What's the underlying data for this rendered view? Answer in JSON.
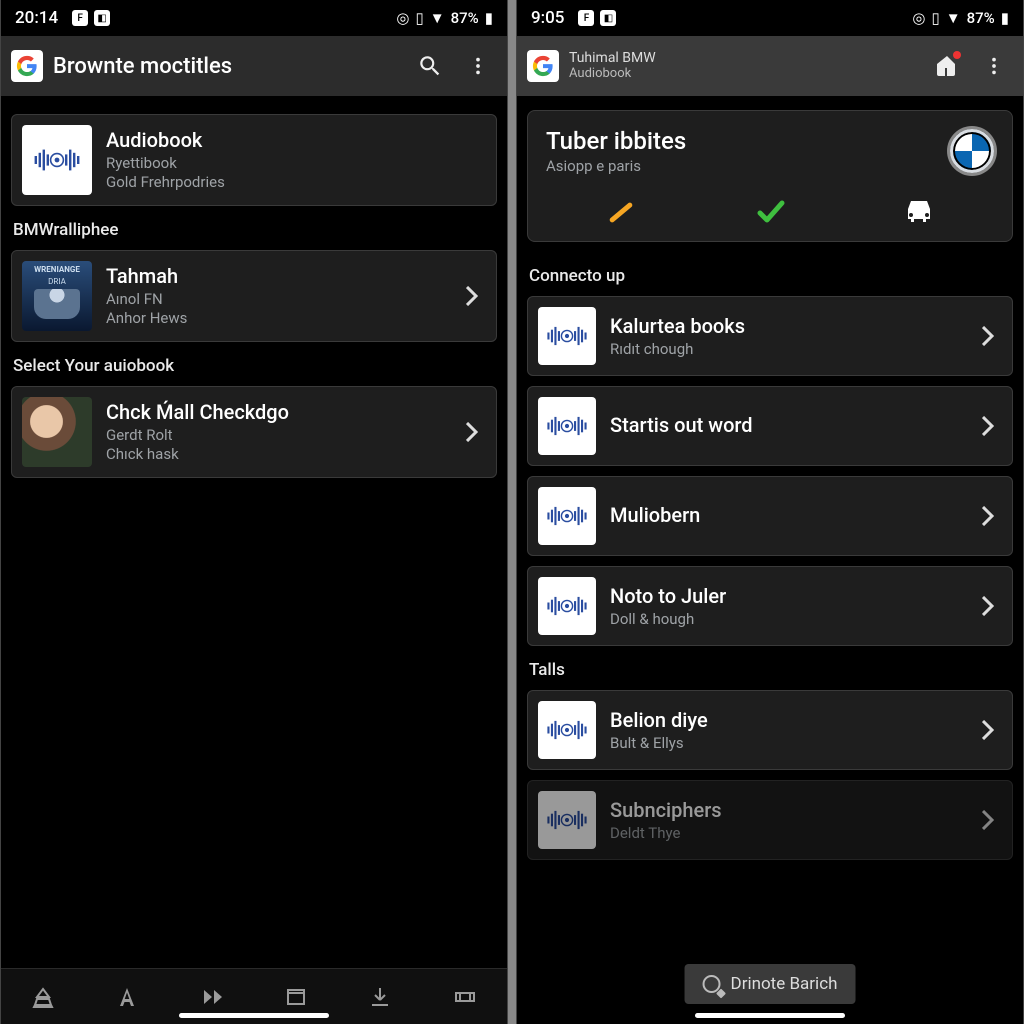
{
  "left": {
    "status": {
      "time": "20:14",
      "battery": "87%"
    },
    "appbar": {
      "title": "Brownte moctitles"
    },
    "featured": {
      "title": "Audiobook",
      "sub1": "Ryettibook",
      "sub2": "Gold Frehrpodries"
    },
    "section1": {
      "header": "BMWralliphee"
    },
    "item1": {
      "thumb_top": "WRENIANGE",
      "thumb_sub": "DRIA",
      "title": "Tahmah",
      "sub1": "Aınol FN",
      "sub2": "Anhor Hews"
    },
    "section2": {
      "header": "Select Your auiobook"
    },
    "item2": {
      "title": "Chck Ḿall Checkdgo",
      "sub1": "Gerdt Rolt",
      "sub2": "Chıck hask"
    }
  },
  "right": {
    "status": {
      "time": "9:05",
      "battery": "87%"
    },
    "appbar": {
      "line1": "Tuhimal BMW",
      "line2": "Audiobook"
    },
    "hero": {
      "title": "Tuber ibbites",
      "subtitle": "Asiopp e paris"
    },
    "sectionA": {
      "header": "Connecto up"
    },
    "listA": [
      {
        "title": "Kalurtea books",
        "sub": "Rıdıt chough"
      },
      {
        "title": "Startis out word",
        "sub": ""
      },
      {
        "title": "Muliobern",
        "sub": ""
      },
      {
        "title": "Noto to Juler",
        "sub": "Doll & hough"
      }
    ],
    "sectionB": {
      "header": "Talls"
    },
    "listB": [
      {
        "title": "Belion diye",
        "sub": "Bult & Ellys"
      },
      {
        "title": "Subnciphers",
        "sub": "Deldt Thye"
      }
    ],
    "overlay": {
      "label": "Drinote Barich"
    }
  }
}
